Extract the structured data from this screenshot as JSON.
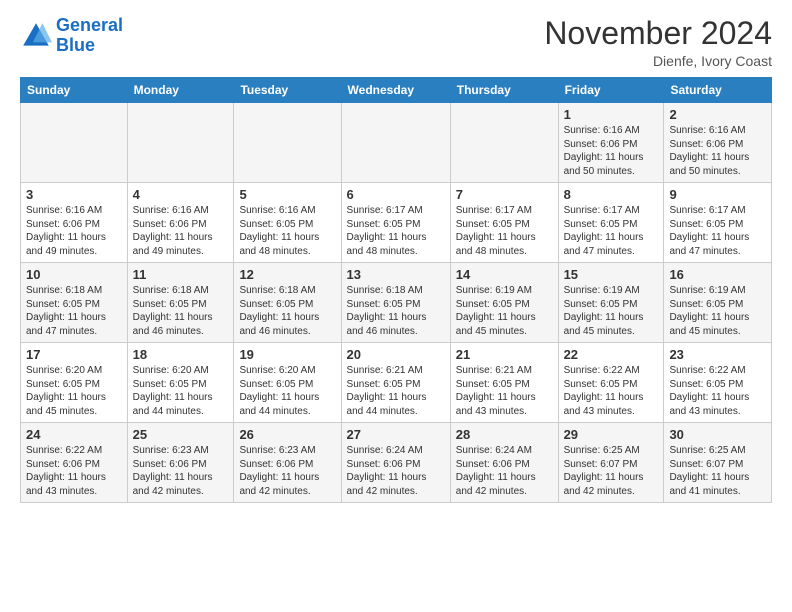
{
  "logo": {
    "line1": "General",
    "line2": "Blue"
  },
  "header": {
    "month": "November 2024",
    "location": "Dienfe, Ivory Coast"
  },
  "weekdays": [
    "Sunday",
    "Monday",
    "Tuesday",
    "Wednesday",
    "Thursday",
    "Friday",
    "Saturday"
  ],
  "weeks": [
    [
      {
        "day": "",
        "info": ""
      },
      {
        "day": "",
        "info": ""
      },
      {
        "day": "",
        "info": ""
      },
      {
        "day": "",
        "info": ""
      },
      {
        "day": "",
        "info": ""
      },
      {
        "day": "1",
        "info": "Sunrise: 6:16 AM\nSunset: 6:06 PM\nDaylight: 11 hours\nand 50 minutes."
      },
      {
        "day": "2",
        "info": "Sunrise: 6:16 AM\nSunset: 6:06 PM\nDaylight: 11 hours\nand 50 minutes."
      }
    ],
    [
      {
        "day": "3",
        "info": "Sunrise: 6:16 AM\nSunset: 6:06 PM\nDaylight: 11 hours\nand 49 minutes."
      },
      {
        "day": "4",
        "info": "Sunrise: 6:16 AM\nSunset: 6:06 PM\nDaylight: 11 hours\nand 49 minutes."
      },
      {
        "day": "5",
        "info": "Sunrise: 6:16 AM\nSunset: 6:05 PM\nDaylight: 11 hours\nand 48 minutes."
      },
      {
        "day": "6",
        "info": "Sunrise: 6:17 AM\nSunset: 6:05 PM\nDaylight: 11 hours\nand 48 minutes."
      },
      {
        "day": "7",
        "info": "Sunrise: 6:17 AM\nSunset: 6:05 PM\nDaylight: 11 hours\nand 48 minutes."
      },
      {
        "day": "8",
        "info": "Sunrise: 6:17 AM\nSunset: 6:05 PM\nDaylight: 11 hours\nand 47 minutes."
      },
      {
        "day": "9",
        "info": "Sunrise: 6:17 AM\nSunset: 6:05 PM\nDaylight: 11 hours\nand 47 minutes."
      }
    ],
    [
      {
        "day": "10",
        "info": "Sunrise: 6:18 AM\nSunset: 6:05 PM\nDaylight: 11 hours\nand 47 minutes."
      },
      {
        "day": "11",
        "info": "Sunrise: 6:18 AM\nSunset: 6:05 PM\nDaylight: 11 hours\nand 46 minutes."
      },
      {
        "day": "12",
        "info": "Sunrise: 6:18 AM\nSunset: 6:05 PM\nDaylight: 11 hours\nand 46 minutes."
      },
      {
        "day": "13",
        "info": "Sunrise: 6:18 AM\nSunset: 6:05 PM\nDaylight: 11 hours\nand 46 minutes."
      },
      {
        "day": "14",
        "info": "Sunrise: 6:19 AM\nSunset: 6:05 PM\nDaylight: 11 hours\nand 45 minutes."
      },
      {
        "day": "15",
        "info": "Sunrise: 6:19 AM\nSunset: 6:05 PM\nDaylight: 11 hours\nand 45 minutes."
      },
      {
        "day": "16",
        "info": "Sunrise: 6:19 AM\nSunset: 6:05 PM\nDaylight: 11 hours\nand 45 minutes."
      }
    ],
    [
      {
        "day": "17",
        "info": "Sunrise: 6:20 AM\nSunset: 6:05 PM\nDaylight: 11 hours\nand 45 minutes."
      },
      {
        "day": "18",
        "info": "Sunrise: 6:20 AM\nSunset: 6:05 PM\nDaylight: 11 hours\nand 44 minutes."
      },
      {
        "day": "19",
        "info": "Sunrise: 6:20 AM\nSunset: 6:05 PM\nDaylight: 11 hours\nand 44 minutes."
      },
      {
        "day": "20",
        "info": "Sunrise: 6:21 AM\nSunset: 6:05 PM\nDaylight: 11 hours\nand 44 minutes."
      },
      {
        "day": "21",
        "info": "Sunrise: 6:21 AM\nSunset: 6:05 PM\nDaylight: 11 hours\nand 43 minutes."
      },
      {
        "day": "22",
        "info": "Sunrise: 6:22 AM\nSunset: 6:05 PM\nDaylight: 11 hours\nand 43 minutes."
      },
      {
        "day": "23",
        "info": "Sunrise: 6:22 AM\nSunset: 6:05 PM\nDaylight: 11 hours\nand 43 minutes."
      }
    ],
    [
      {
        "day": "24",
        "info": "Sunrise: 6:22 AM\nSunset: 6:06 PM\nDaylight: 11 hours\nand 43 minutes."
      },
      {
        "day": "25",
        "info": "Sunrise: 6:23 AM\nSunset: 6:06 PM\nDaylight: 11 hours\nand 42 minutes."
      },
      {
        "day": "26",
        "info": "Sunrise: 6:23 AM\nSunset: 6:06 PM\nDaylight: 11 hours\nand 42 minutes."
      },
      {
        "day": "27",
        "info": "Sunrise: 6:24 AM\nSunset: 6:06 PM\nDaylight: 11 hours\nand 42 minutes."
      },
      {
        "day": "28",
        "info": "Sunrise: 6:24 AM\nSunset: 6:06 PM\nDaylight: 11 hours\nand 42 minutes."
      },
      {
        "day": "29",
        "info": "Sunrise: 6:25 AM\nSunset: 6:07 PM\nDaylight: 11 hours\nand 42 minutes."
      },
      {
        "day": "30",
        "info": "Sunrise: 6:25 AM\nSunset: 6:07 PM\nDaylight: 11 hours\nand 41 minutes."
      }
    ]
  ]
}
